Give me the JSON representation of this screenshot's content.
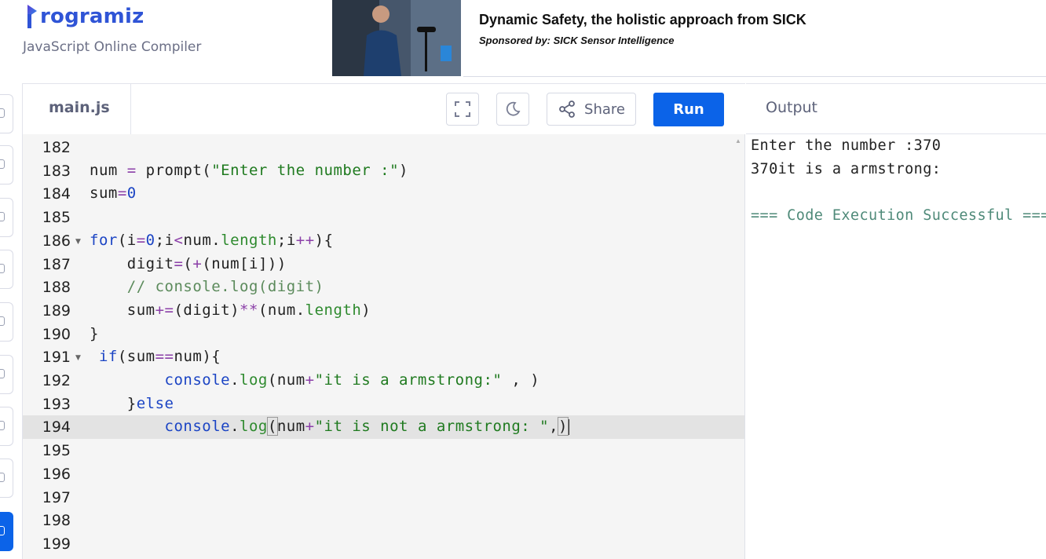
{
  "brand": {
    "name": "rogramiz",
    "subtitle": "JavaScript Online Compiler"
  },
  "ad": {
    "title": "Dynamic Safety, the holistic approach from SICK",
    "sponsor": "Sponsored by: SICK Sensor Intelligence"
  },
  "editor": {
    "file_tab": "main.js",
    "buttons": {
      "expand": "expand-icon",
      "theme": "moon-icon",
      "share": "Share",
      "run": "Run"
    },
    "lines": [
      {
        "n": "182",
        "fold": false,
        "text": ""
      },
      {
        "n": "183",
        "fold": false,
        "text": "num = prompt(\"Enter the number :\")"
      },
      {
        "n": "184",
        "fold": false,
        "text": "sum=0"
      },
      {
        "n": "185",
        "fold": false,
        "text": ""
      },
      {
        "n": "186",
        "fold": true,
        "text": "for(i=0;i<num.length;i++){"
      },
      {
        "n": "187",
        "fold": false,
        "text": "    digit=(+(num[i]))"
      },
      {
        "n": "188",
        "fold": false,
        "text": "    // console.log(digit)"
      },
      {
        "n": "189",
        "fold": false,
        "text": "    sum+=(digit)**(num.length)"
      },
      {
        "n": "190",
        "fold": false,
        "text": "}"
      },
      {
        "n": "191",
        "fold": true,
        "text": " if(sum==num){"
      },
      {
        "n": "192",
        "fold": false,
        "text": "        console.log(num+\"it is a armstrong:\" , )"
      },
      {
        "n": "193",
        "fold": false,
        "text": "    }else"
      },
      {
        "n": "194",
        "fold": false,
        "text": "        console.log(num+\"it is not a armstrong: \",)"
      },
      {
        "n": "195",
        "fold": false,
        "text": ""
      },
      {
        "n": "196",
        "fold": false,
        "text": ""
      },
      {
        "n": "197",
        "fold": false,
        "text": ""
      },
      {
        "n": "198",
        "fold": false,
        "text": ""
      },
      {
        "n": "199",
        "fold": false,
        "text": ""
      }
    ],
    "active_line": "194"
  },
  "output": {
    "title": "Output",
    "lines": [
      "Enter the number :370",
      "370it is a armstrong:",
      "",
      "=== Code Execution Successful ==="
    ]
  },
  "colors": {
    "accent": "#0b63e8",
    "brand": "#2f54d6",
    "success": "#4f8a79"
  }
}
